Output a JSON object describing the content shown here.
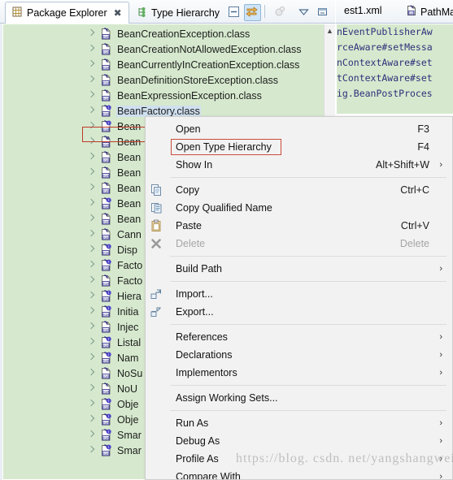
{
  "colors": {
    "tree_background": "#d6e9ce",
    "tree_selection": "#cfe0ef",
    "highlight_border": "#c0392b",
    "menu_background": "#f2f2f2",
    "code_text": "#2f2f7a",
    "toolbar_active": "#cfe4f7"
  },
  "view_tabs": [
    {
      "label": "Package Explorer",
      "icon": "package-explorer-icon",
      "active": true,
      "close": "✖"
    },
    {
      "label": "Type Hierarchy",
      "icon": "type-hierarchy-icon",
      "active": false
    }
  ],
  "view_toolbar": [
    {
      "name": "collapse-all-icon",
      "tooltip": "Collapse All"
    },
    {
      "name": "link-with-editor-icon",
      "tooltip": "Link with Editor"
    },
    {
      "name": "focus-on-active-task-icon",
      "tooltip": "Focus on Active Task"
    },
    {
      "name": "view-menu-icon",
      "tooltip": "View Menu"
    },
    {
      "name": "minimize-icon",
      "tooltip": "Minimize"
    }
  ],
  "editor_tabs": [
    {
      "label": "est1.xml",
      "icon": "xml-file-icon"
    },
    {
      "label": "PathMa",
      "icon": "class-file-icon"
    }
  ],
  "editor_code_lines": [
    "nEventPublisherAw",
    "rceAware#setMessa",
    "nContextAware#set",
    "tContextAware#set",
    "ig.BeanPostProces"
  ],
  "tree": {
    "scrollbar": {
      "up_arrow": "▲"
    },
    "rows": [
      {
        "label": "BeanCreationException.class",
        "icon": "class-file-icon",
        "selected": false
      },
      {
        "label": "BeanCreationNotAllowedException.class",
        "icon": "class-file-icon",
        "selected": false
      },
      {
        "label": "BeanCurrentlyInCreationException.class",
        "icon": "class-file-icon",
        "selected": false
      },
      {
        "label": "BeanDefinitionStoreException.class",
        "icon": "class-file-icon",
        "selected": false
      },
      {
        "label": "BeanExpressionException.class",
        "icon": "class-file-icon",
        "selected": false
      },
      {
        "label": "BeanFactory.class",
        "icon": "interface-file-icon",
        "selected": true
      },
      {
        "label": "Bean",
        "icon": "interface-file-icon",
        "selected": false
      },
      {
        "label": "Bean",
        "icon": "abstract-class-file-icon",
        "selected": false
      },
      {
        "label": "Bean",
        "icon": "class-file-icon",
        "selected": false
      },
      {
        "label": "Bean",
        "icon": "class-file-icon",
        "selected": false
      },
      {
        "label": "Bean",
        "icon": "class-file-icon",
        "selected": false
      },
      {
        "label": "Bean",
        "icon": "interface-file-icon",
        "selected": false
      },
      {
        "label": "Bean",
        "icon": "class-file-icon",
        "selected": false
      },
      {
        "label": "Cann",
        "icon": "class-file-icon",
        "selected": false
      },
      {
        "label": "Disp",
        "icon": "interface-file-icon",
        "selected": false
      },
      {
        "label": "Facto",
        "icon": "interface-file-icon",
        "selected": false
      },
      {
        "label": "Facto",
        "icon": "class-file-icon",
        "selected": false
      },
      {
        "label": "Hiera",
        "icon": "interface-file-icon",
        "selected": false
      },
      {
        "label": "Initia",
        "icon": "interface-file-icon",
        "selected": false
      },
      {
        "label": "Injec",
        "icon": "class-file-icon",
        "selected": false
      },
      {
        "label": "Listal",
        "icon": "interface-file-icon",
        "selected": false
      },
      {
        "label": "Nam",
        "icon": "interface-file-icon",
        "selected": false
      },
      {
        "label": "NoSu",
        "icon": "class-file-icon",
        "selected": false
      },
      {
        "label": "NoU",
        "icon": "class-file-icon",
        "selected": false
      },
      {
        "label": "Obje",
        "icon": "interface-file-icon",
        "selected": false
      },
      {
        "label": "Obje",
        "icon": "interface-file-icon",
        "selected": false
      },
      {
        "label": "Smar",
        "icon": "interface-file-icon",
        "selected": false
      },
      {
        "label": "Smar",
        "icon": "interface-file-icon",
        "selected": false
      }
    ]
  },
  "context_menu": {
    "items": [
      {
        "label": "Open",
        "accel": "F3",
        "icon": null,
        "arrow": false,
        "disabled": false,
        "highlighted": false
      },
      {
        "label": "Open Type Hierarchy",
        "accel": "F4",
        "icon": null,
        "arrow": false,
        "disabled": false,
        "highlighted": true
      },
      {
        "label": "Show In",
        "accel": "Alt+Shift+W",
        "icon": null,
        "arrow": true,
        "disabled": false,
        "highlighted": false
      },
      {
        "separator": true
      },
      {
        "label": "Copy",
        "accel": "Ctrl+C",
        "icon": "copy-icon",
        "arrow": false,
        "disabled": false,
        "highlighted": false
      },
      {
        "label": "Copy Qualified Name",
        "accel": "",
        "icon": "copy-qualified-icon",
        "arrow": false,
        "disabled": false,
        "highlighted": false
      },
      {
        "label": "Paste",
        "accel": "Ctrl+V",
        "icon": "paste-icon",
        "arrow": false,
        "disabled": false,
        "highlighted": false
      },
      {
        "label": "Delete",
        "accel": "Delete",
        "icon": "delete-icon",
        "arrow": false,
        "disabled": true,
        "highlighted": false
      },
      {
        "separator": true
      },
      {
        "label": "Build Path",
        "accel": "",
        "icon": null,
        "arrow": true,
        "disabled": false,
        "highlighted": false
      },
      {
        "separator": true
      },
      {
        "label": "Import...",
        "accel": "",
        "icon": "import-icon",
        "arrow": false,
        "disabled": false,
        "highlighted": false
      },
      {
        "label": "Export...",
        "accel": "",
        "icon": "export-icon",
        "arrow": false,
        "disabled": false,
        "highlighted": false
      },
      {
        "separator": true
      },
      {
        "label": "References",
        "accel": "",
        "icon": null,
        "arrow": true,
        "disabled": false,
        "highlighted": false
      },
      {
        "label": "Declarations",
        "accel": "",
        "icon": null,
        "arrow": true,
        "disabled": false,
        "highlighted": false
      },
      {
        "label": "Implementors",
        "accel": "",
        "icon": null,
        "arrow": true,
        "disabled": false,
        "highlighted": false
      },
      {
        "separator": true
      },
      {
        "label": "Assign Working Sets...",
        "accel": "",
        "icon": null,
        "arrow": false,
        "disabled": false,
        "highlighted": false
      },
      {
        "separator": true
      },
      {
        "label": "Run As",
        "accel": "",
        "icon": null,
        "arrow": true,
        "disabled": false,
        "highlighted": false
      },
      {
        "label": "Debug As",
        "accel": "",
        "icon": null,
        "arrow": true,
        "disabled": false,
        "highlighted": false
      },
      {
        "label": "Profile As",
        "accel": "",
        "icon": null,
        "arrow": true,
        "disabled": false,
        "highlighted": false
      },
      {
        "label": "Compare With",
        "accel": "",
        "icon": null,
        "arrow": true,
        "disabled": false,
        "highlighted": false
      }
    ]
  },
  "watermark": {
    "line1": "https://blog. csdn. net/yangshangwei",
    "line2": ""
  }
}
